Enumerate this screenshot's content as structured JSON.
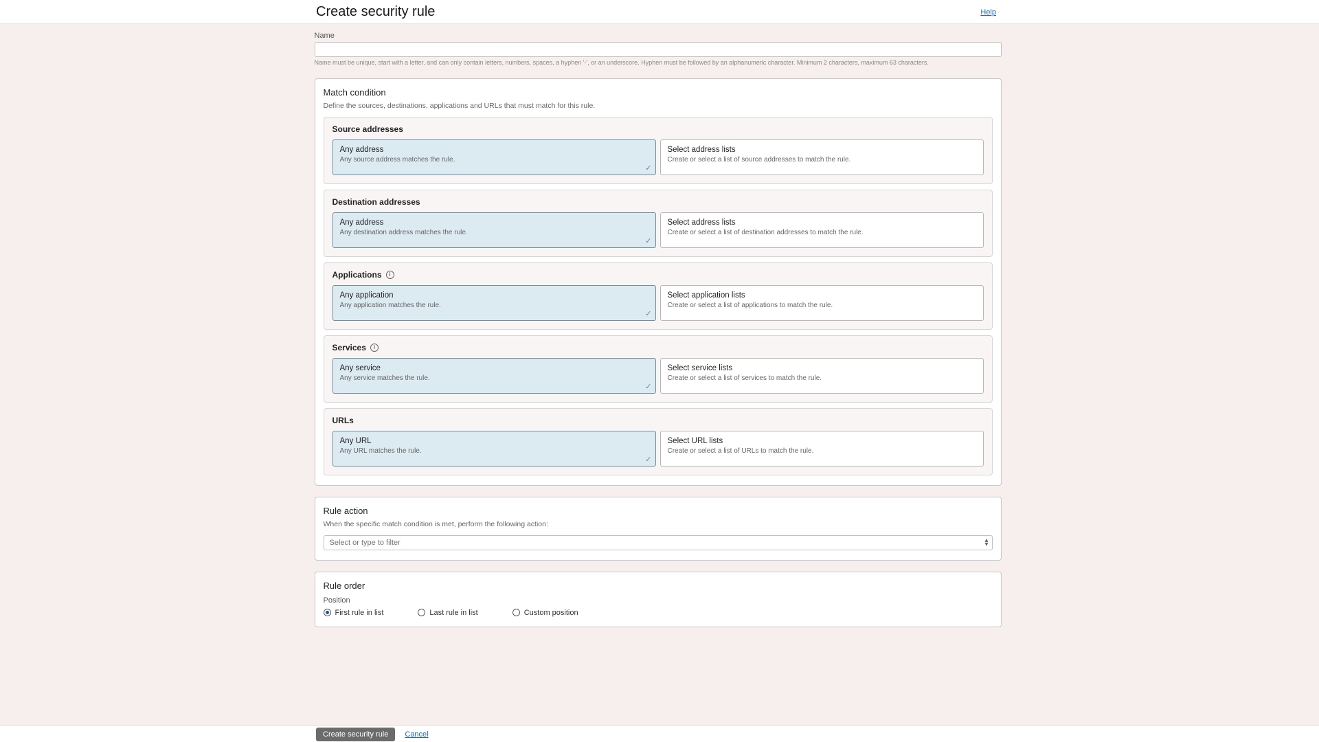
{
  "header": {
    "title": "Create security rule",
    "help": "Help"
  },
  "name": {
    "label": "Name",
    "value": "",
    "hint": "Name must be unique, start with a letter, and can only contain letters, numbers, spaces, a hyphen '-', or an underscore. Hyphen must be followed by an alphanumeric character. Minimum 2 characters, maximum 63 characters."
  },
  "match": {
    "title": "Match condition",
    "subtitle": "Define the sources, destinations, applications and URLs that must match for this rule.",
    "sections": {
      "source": {
        "title": "Source addresses",
        "optA": {
          "title": "Any address",
          "desc": "Any source address matches the rule."
        },
        "optB": {
          "title": "Select address lists",
          "desc": "Create or select a list of source addresses to match the rule."
        }
      },
      "dest": {
        "title": "Destination addresses",
        "optA": {
          "title": "Any address",
          "desc": "Any destination address matches the rule."
        },
        "optB": {
          "title": "Select address lists",
          "desc": "Create or select a list of destination ad­dresses to match the rule."
        }
      },
      "apps": {
        "title": "Applications",
        "optA": {
          "title": "Any application",
          "desc": "Any application matches the rule."
        },
        "optB": {
          "title": "Select application lists",
          "desc": "Create or select a list of applications to match the rule."
        }
      },
      "services": {
        "title": "Services",
        "optA": {
          "title": "Any service",
          "desc": "Any service matches the rule."
        },
        "optB": {
          "title": "Select service lists",
          "desc": "Create or select a list of services to match the rule."
        }
      },
      "urls": {
        "title": "URLs",
        "optA": {
          "title": "Any URL",
          "desc": "Any URL matches the rule."
        },
        "optB": {
          "title": "Select URL lists",
          "desc": "Create or select a list of URLs to match the rule."
        }
      }
    }
  },
  "action": {
    "title": "Rule action",
    "subtitle": "When the specific match condition is met, perform the following action:",
    "placeholder": "Select or type to filter"
  },
  "order": {
    "title": "Rule order",
    "position_label": "Position",
    "opts": {
      "first": "First rule in list",
      "last": "Last rule in list",
      "custom": "Custom position"
    }
  },
  "footer": {
    "create": "Create security rule",
    "cancel": "Cancel"
  }
}
